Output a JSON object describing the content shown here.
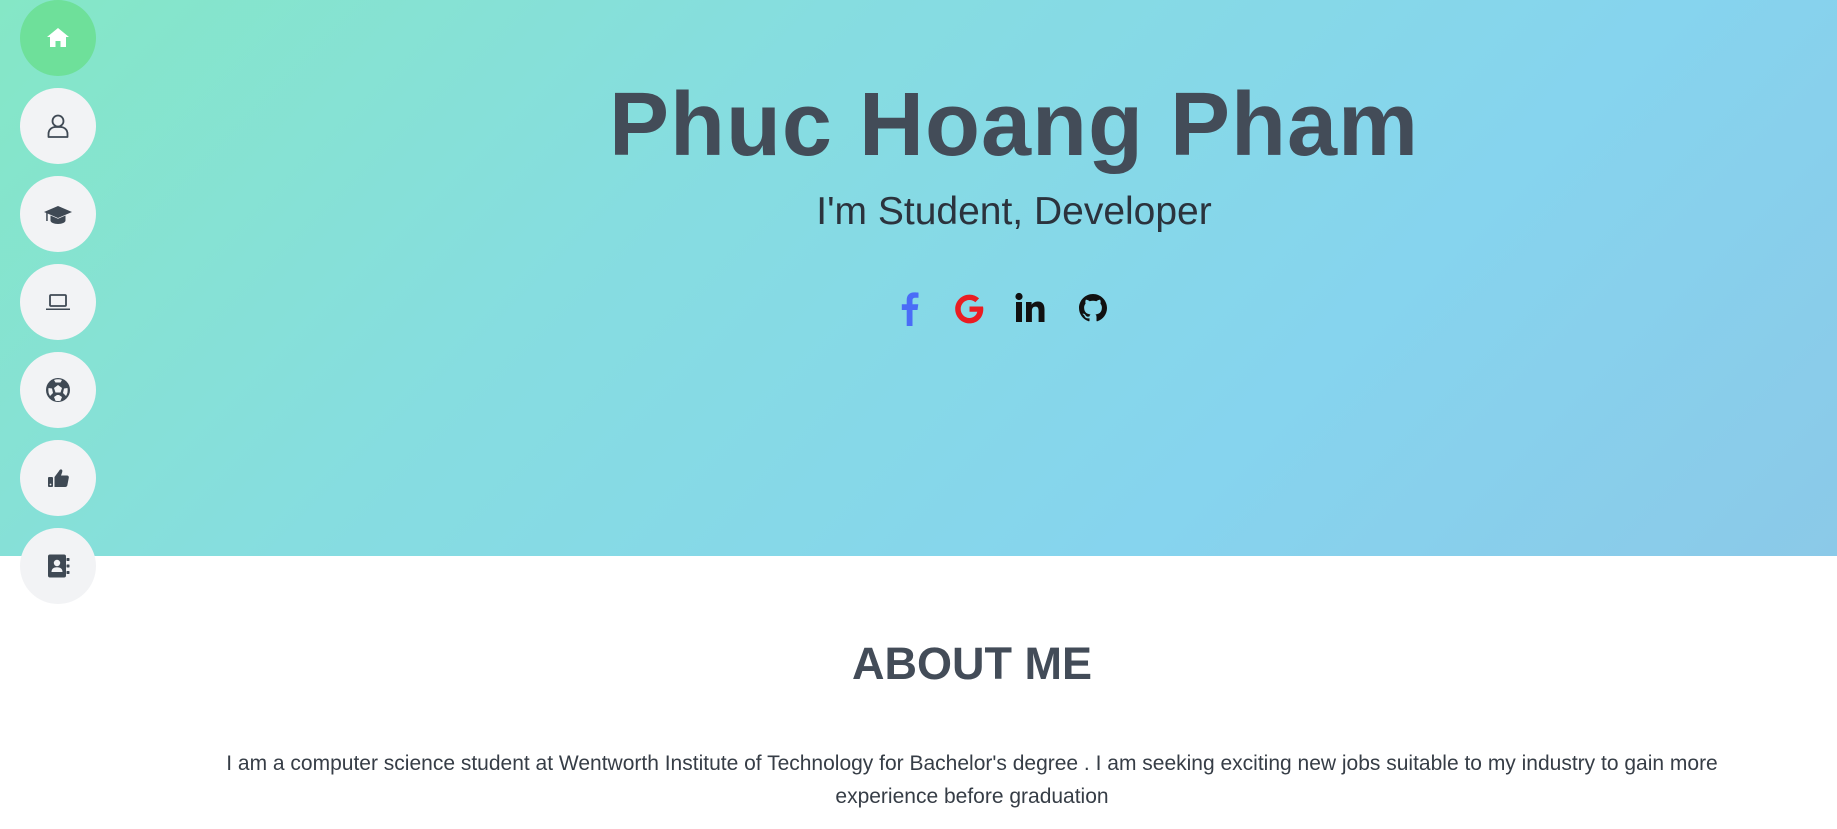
{
  "hero": {
    "name": "Phuc Hoang Pham",
    "role": "I'm Student, Developer"
  },
  "socials": [
    {
      "icon": "facebook-icon",
      "color": "#4a6cf7"
    },
    {
      "icon": "google-icon",
      "color": "#ea1d22"
    },
    {
      "icon": "linkedin-icon",
      "color": "#111111"
    },
    {
      "icon": "github-icon",
      "color": "#111111"
    }
  ],
  "nav": {
    "items": [
      {
        "icon": "home-icon",
        "active": true
      },
      {
        "icon": "user-icon",
        "active": false
      },
      {
        "icon": "graduation-cap-icon",
        "active": false
      },
      {
        "icon": "laptop-icon",
        "active": false
      },
      {
        "icon": "soccer-ball-icon",
        "active": false
      },
      {
        "icon": "thumbs-up-icon",
        "active": false
      },
      {
        "icon": "address-book-icon",
        "active": false
      }
    ]
  },
  "about": {
    "title": "ABOUT ME",
    "text": "I am a computer science student at Wentworth Institute of Technology for Bachelor's degree . I am seeking exciting new jobs suitable to my industry to gain more experience before graduation"
  },
  "colors": {
    "accent_green": "#6ee09a",
    "heading": "#434c58",
    "nav_bg": "#f2f3f5"
  }
}
